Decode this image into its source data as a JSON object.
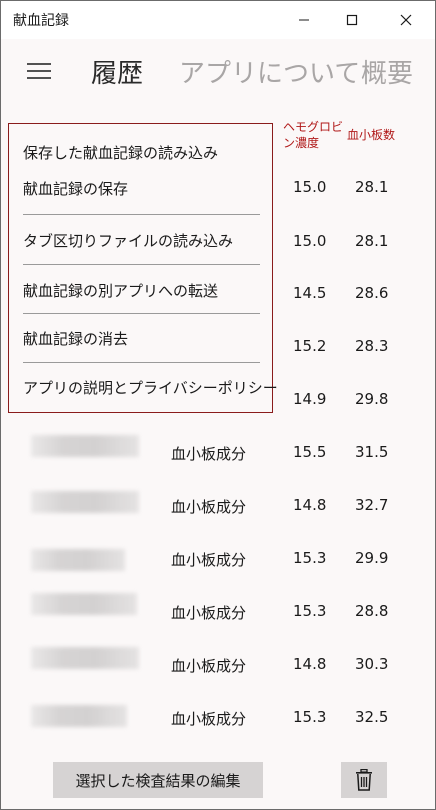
{
  "window": {
    "title": "献血記録",
    "controls": {
      "minimize_icon": "minimize-icon",
      "maximize_icon": "maximize-icon",
      "close_icon": "close-icon"
    }
  },
  "nav": {
    "menu_icon": "hamburger-icon",
    "tabs": [
      {
        "label": "履歴",
        "active": true
      },
      {
        "label": "アプリについて",
        "active": false
      },
      {
        "label": "概要",
        "active": false
      }
    ]
  },
  "table": {
    "headers": {
      "hemoglobin": "ヘモグロビン濃度",
      "platelet": "血小板数"
    },
    "rows": [
      {
        "type": "",
        "hemoglobin": "15.0",
        "platelet": "28.1"
      },
      {
        "type": "",
        "hemoglobin": "15.0",
        "platelet": "28.1"
      },
      {
        "type": "",
        "hemoglobin": "14.5",
        "platelet": "28.6"
      },
      {
        "type": "",
        "hemoglobin": "15.2",
        "platelet": "28.3"
      },
      {
        "type": "",
        "hemoglobin": "14.9",
        "platelet": "29.8"
      },
      {
        "type": "血小板成分",
        "hemoglobin": "15.5",
        "platelet": "31.5"
      },
      {
        "type": "血小板成分",
        "hemoglobin": "14.8",
        "platelet": "32.7"
      },
      {
        "type": "血小板成分",
        "hemoglobin": "15.3",
        "platelet": "29.9"
      },
      {
        "type": "血小板成分",
        "hemoglobin": "15.3",
        "platelet": "28.8"
      },
      {
        "type": "血小板成分",
        "hemoglobin": "14.8",
        "platelet": "30.3"
      },
      {
        "type": "血小板成分",
        "hemoglobin": "15.3",
        "platelet": "32.5"
      }
    ]
  },
  "menu": {
    "items": [
      {
        "label": "保存した献血記録の読み込み"
      },
      {
        "label": "献血記録の保存"
      },
      {
        "label": "タブ区切りファイルの読み込み"
      },
      {
        "label": "献血記録の別アプリへの転送"
      },
      {
        "label": "献血記録の消去"
      },
      {
        "label": "アプリの説明とプライバシーポリシー"
      }
    ]
  },
  "footer": {
    "edit_label": "選択した検査結果の編集",
    "delete_icon": "trash-icon"
  },
  "colors": {
    "accent_red": "#b01818",
    "menu_border": "#8a1c1c",
    "background": "#fbf8f8",
    "button_bg": "#d6d3d3"
  }
}
